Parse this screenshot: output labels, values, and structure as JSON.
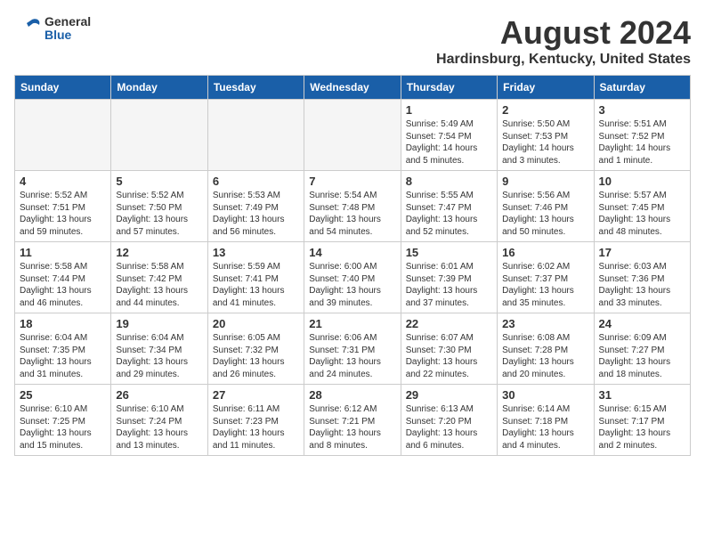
{
  "header": {
    "logo_line1": "General",
    "logo_line2": "Blue",
    "title": "August 2024",
    "subtitle": "Hardinsburg, Kentucky, United States"
  },
  "weekdays": [
    "Sunday",
    "Monday",
    "Tuesday",
    "Wednesday",
    "Thursday",
    "Friday",
    "Saturday"
  ],
  "weeks": [
    [
      {
        "day": "",
        "info": ""
      },
      {
        "day": "",
        "info": ""
      },
      {
        "day": "",
        "info": ""
      },
      {
        "day": "",
        "info": ""
      },
      {
        "day": "1",
        "info": "Sunrise: 5:49 AM\nSunset: 7:54 PM\nDaylight: 14 hours\nand 5 minutes."
      },
      {
        "day": "2",
        "info": "Sunrise: 5:50 AM\nSunset: 7:53 PM\nDaylight: 14 hours\nand 3 minutes."
      },
      {
        "day": "3",
        "info": "Sunrise: 5:51 AM\nSunset: 7:52 PM\nDaylight: 14 hours\nand 1 minute."
      }
    ],
    [
      {
        "day": "4",
        "info": "Sunrise: 5:52 AM\nSunset: 7:51 PM\nDaylight: 13 hours\nand 59 minutes."
      },
      {
        "day": "5",
        "info": "Sunrise: 5:52 AM\nSunset: 7:50 PM\nDaylight: 13 hours\nand 57 minutes."
      },
      {
        "day": "6",
        "info": "Sunrise: 5:53 AM\nSunset: 7:49 PM\nDaylight: 13 hours\nand 56 minutes."
      },
      {
        "day": "7",
        "info": "Sunrise: 5:54 AM\nSunset: 7:48 PM\nDaylight: 13 hours\nand 54 minutes."
      },
      {
        "day": "8",
        "info": "Sunrise: 5:55 AM\nSunset: 7:47 PM\nDaylight: 13 hours\nand 52 minutes."
      },
      {
        "day": "9",
        "info": "Sunrise: 5:56 AM\nSunset: 7:46 PM\nDaylight: 13 hours\nand 50 minutes."
      },
      {
        "day": "10",
        "info": "Sunrise: 5:57 AM\nSunset: 7:45 PM\nDaylight: 13 hours\nand 48 minutes."
      }
    ],
    [
      {
        "day": "11",
        "info": "Sunrise: 5:58 AM\nSunset: 7:44 PM\nDaylight: 13 hours\nand 46 minutes."
      },
      {
        "day": "12",
        "info": "Sunrise: 5:58 AM\nSunset: 7:42 PM\nDaylight: 13 hours\nand 44 minutes."
      },
      {
        "day": "13",
        "info": "Sunrise: 5:59 AM\nSunset: 7:41 PM\nDaylight: 13 hours\nand 41 minutes."
      },
      {
        "day": "14",
        "info": "Sunrise: 6:00 AM\nSunset: 7:40 PM\nDaylight: 13 hours\nand 39 minutes."
      },
      {
        "day": "15",
        "info": "Sunrise: 6:01 AM\nSunset: 7:39 PM\nDaylight: 13 hours\nand 37 minutes."
      },
      {
        "day": "16",
        "info": "Sunrise: 6:02 AM\nSunset: 7:37 PM\nDaylight: 13 hours\nand 35 minutes."
      },
      {
        "day": "17",
        "info": "Sunrise: 6:03 AM\nSunset: 7:36 PM\nDaylight: 13 hours\nand 33 minutes."
      }
    ],
    [
      {
        "day": "18",
        "info": "Sunrise: 6:04 AM\nSunset: 7:35 PM\nDaylight: 13 hours\nand 31 minutes."
      },
      {
        "day": "19",
        "info": "Sunrise: 6:04 AM\nSunset: 7:34 PM\nDaylight: 13 hours\nand 29 minutes."
      },
      {
        "day": "20",
        "info": "Sunrise: 6:05 AM\nSunset: 7:32 PM\nDaylight: 13 hours\nand 26 minutes."
      },
      {
        "day": "21",
        "info": "Sunrise: 6:06 AM\nSunset: 7:31 PM\nDaylight: 13 hours\nand 24 minutes."
      },
      {
        "day": "22",
        "info": "Sunrise: 6:07 AM\nSunset: 7:30 PM\nDaylight: 13 hours\nand 22 minutes."
      },
      {
        "day": "23",
        "info": "Sunrise: 6:08 AM\nSunset: 7:28 PM\nDaylight: 13 hours\nand 20 minutes."
      },
      {
        "day": "24",
        "info": "Sunrise: 6:09 AM\nSunset: 7:27 PM\nDaylight: 13 hours\nand 18 minutes."
      }
    ],
    [
      {
        "day": "25",
        "info": "Sunrise: 6:10 AM\nSunset: 7:25 PM\nDaylight: 13 hours\nand 15 minutes."
      },
      {
        "day": "26",
        "info": "Sunrise: 6:10 AM\nSunset: 7:24 PM\nDaylight: 13 hours\nand 13 minutes."
      },
      {
        "day": "27",
        "info": "Sunrise: 6:11 AM\nSunset: 7:23 PM\nDaylight: 13 hours\nand 11 minutes."
      },
      {
        "day": "28",
        "info": "Sunrise: 6:12 AM\nSunset: 7:21 PM\nDaylight: 13 hours\nand 8 minutes."
      },
      {
        "day": "29",
        "info": "Sunrise: 6:13 AM\nSunset: 7:20 PM\nDaylight: 13 hours\nand 6 minutes."
      },
      {
        "day": "30",
        "info": "Sunrise: 6:14 AM\nSunset: 7:18 PM\nDaylight: 13 hours\nand 4 minutes."
      },
      {
        "day": "31",
        "info": "Sunrise: 6:15 AM\nSunset: 7:17 PM\nDaylight: 13 hours\nand 2 minutes."
      }
    ]
  ]
}
